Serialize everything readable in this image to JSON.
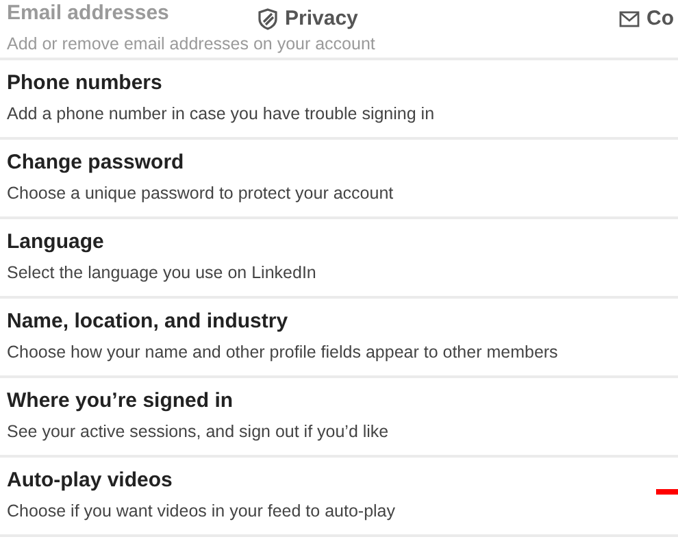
{
  "tabs": [
    {
      "label": "Privacy",
      "kind": "shield"
    },
    {
      "label": "Co",
      "kind": "mail"
    }
  ],
  "settings": [
    {
      "title": "Email addresses",
      "description": "Add or remove email addresses on your account",
      "faded": true,
      "marked": false
    },
    {
      "title": "Phone numbers",
      "description": "Add a phone number in case you have trouble signing in",
      "faded": false,
      "marked": false
    },
    {
      "title": "Change password",
      "description": "Choose a unique password to protect your account",
      "faded": false,
      "marked": false
    },
    {
      "title": "Language",
      "description": "Select the language you use on LinkedIn",
      "faded": false,
      "marked": false
    },
    {
      "title": "Name, location, and industry",
      "description": "Choose how your name and other profile fields appear to other members",
      "faded": false,
      "marked": false
    },
    {
      "title": "Where you’re signed in",
      "description": "See your active sessions, and sign out if you’d like",
      "faded": false,
      "marked": false
    },
    {
      "title": "Auto-play videos",
      "description": "Choose if you want videos in your feed to auto-play",
      "faded": false,
      "marked": true
    }
  ]
}
